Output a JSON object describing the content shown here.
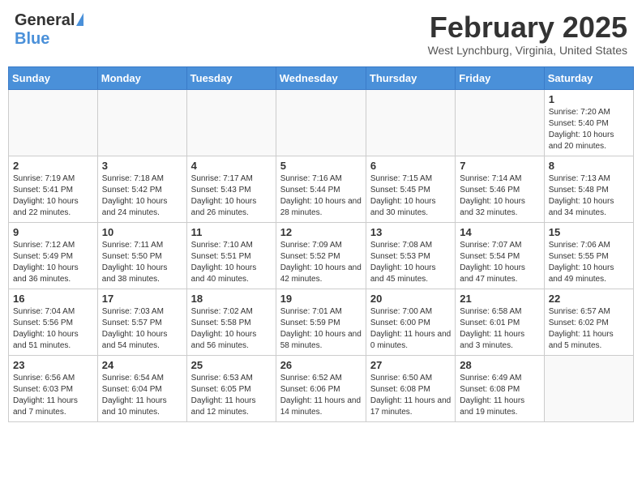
{
  "header": {
    "logo_general": "General",
    "logo_blue": "Blue",
    "month_title": "February 2025",
    "location": "West Lynchburg, Virginia, United States"
  },
  "calendar": {
    "days_of_week": [
      "Sunday",
      "Monday",
      "Tuesday",
      "Wednesday",
      "Thursday",
      "Friday",
      "Saturday"
    ],
    "weeks": [
      [
        {
          "day": "",
          "info": ""
        },
        {
          "day": "",
          "info": ""
        },
        {
          "day": "",
          "info": ""
        },
        {
          "day": "",
          "info": ""
        },
        {
          "day": "",
          "info": ""
        },
        {
          "day": "",
          "info": ""
        },
        {
          "day": "1",
          "info": "Sunrise: 7:20 AM\nSunset: 5:40 PM\nDaylight: 10 hours\nand 20 minutes."
        }
      ],
      [
        {
          "day": "2",
          "info": "Sunrise: 7:19 AM\nSunset: 5:41 PM\nDaylight: 10 hours\nand 22 minutes."
        },
        {
          "day": "3",
          "info": "Sunrise: 7:18 AM\nSunset: 5:42 PM\nDaylight: 10 hours\nand 24 minutes."
        },
        {
          "day": "4",
          "info": "Sunrise: 7:17 AM\nSunset: 5:43 PM\nDaylight: 10 hours\nand 26 minutes."
        },
        {
          "day": "5",
          "info": "Sunrise: 7:16 AM\nSunset: 5:44 PM\nDaylight: 10 hours\nand 28 minutes."
        },
        {
          "day": "6",
          "info": "Sunrise: 7:15 AM\nSunset: 5:45 PM\nDaylight: 10 hours\nand 30 minutes."
        },
        {
          "day": "7",
          "info": "Sunrise: 7:14 AM\nSunset: 5:46 PM\nDaylight: 10 hours\nand 32 minutes."
        },
        {
          "day": "8",
          "info": "Sunrise: 7:13 AM\nSunset: 5:48 PM\nDaylight: 10 hours\nand 34 minutes."
        }
      ],
      [
        {
          "day": "9",
          "info": "Sunrise: 7:12 AM\nSunset: 5:49 PM\nDaylight: 10 hours\nand 36 minutes."
        },
        {
          "day": "10",
          "info": "Sunrise: 7:11 AM\nSunset: 5:50 PM\nDaylight: 10 hours\nand 38 minutes."
        },
        {
          "day": "11",
          "info": "Sunrise: 7:10 AM\nSunset: 5:51 PM\nDaylight: 10 hours\nand 40 minutes."
        },
        {
          "day": "12",
          "info": "Sunrise: 7:09 AM\nSunset: 5:52 PM\nDaylight: 10 hours\nand 42 minutes."
        },
        {
          "day": "13",
          "info": "Sunrise: 7:08 AM\nSunset: 5:53 PM\nDaylight: 10 hours\nand 45 minutes."
        },
        {
          "day": "14",
          "info": "Sunrise: 7:07 AM\nSunset: 5:54 PM\nDaylight: 10 hours\nand 47 minutes."
        },
        {
          "day": "15",
          "info": "Sunrise: 7:06 AM\nSunset: 5:55 PM\nDaylight: 10 hours\nand 49 minutes."
        }
      ],
      [
        {
          "day": "16",
          "info": "Sunrise: 7:04 AM\nSunset: 5:56 PM\nDaylight: 10 hours\nand 51 minutes."
        },
        {
          "day": "17",
          "info": "Sunrise: 7:03 AM\nSunset: 5:57 PM\nDaylight: 10 hours\nand 54 minutes."
        },
        {
          "day": "18",
          "info": "Sunrise: 7:02 AM\nSunset: 5:58 PM\nDaylight: 10 hours\nand 56 minutes."
        },
        {
          "day": "19",
          "info": "Sunrise: 7:01 AM\nSunset: 5:59 PM\nDaylight: 10 hours\nand 58 minutes."
        },
        {
          "day": "20",
          "info": "Sunrise: 7:00 AM\nSunset: 6:00 PM\nDaylight: 11 hours\nand 0 minutes."
        },
        {
          "day": "21",
          "info": "Sunrise: 6:58 AM\nSunset: 6:01 PM\nDaylight: 11 hours\nand 3 minutes."
        },
        {
          "day": "22",
          "info": "Sunrise: 6:57 AM\nSunset: 6:02 PM\nDaylight: 11 hours\nand 5 minutes."
        }
      ],
      [
        {
          "day": "23",
          "info": "Sunrise: 6:56 AM\nSunset: 6:03 PM\nDaylight: 11 hours\nand 7 minutes."
        },
        {
          "day": "24",
          "info": "Sunrise: 6:54 AM\nSunset: 6:04 PM\nDaylight: 11 hours\nand 10 minutes."
        },
        {
          "day": "25",
          "info": "Sunrise: 6:53 AM\nSunset: 6:05 PM\nDaylight: 11 hours\nand 12 minutes."
        },
        {
          "day": "26",
          "info": "Sunrise: 6:52 AM\nSunset: 6:06 PM\nDaylight: 11 hours\nand 14 minutes."
        },
        {
          "day": "27",
          "info": "Sunrise: 6:50 AM\nSunset: 6:08 PM\nDaylight: 11 hours\nand 17 minutes."
        },
        {
          "day": "28",
          "info": "Sunrise: 6:49 AM\nSunset: 6:08 PM\nDaylight: 11 hours\nand 19 minutes."
        },
        {
          "day": "",
          "info": ""
        }
      ]
    ]
  }
}
